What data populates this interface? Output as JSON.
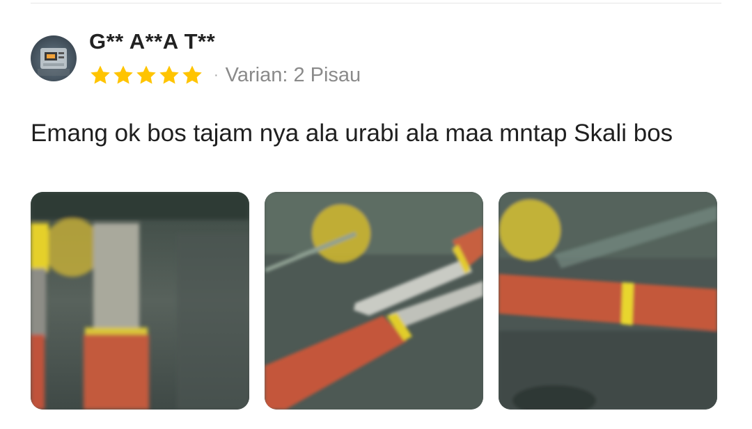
{
  "review": {
    "username": "G** A**A T**",
    "rating": 5,
    "rating_max": 5,
    "separator": "·",
    "variant": "Varian: 2 Pisau",
    "text": "Emang ok bos tajam nya ala urabi ala maa mntap Skali bos",
    "star_color": "#FFC400"
  },
  "photos": [
    {
      "name": "review-photo-1"
    },
    {
      "name": "review-photo-2"
    },
    {
      "name": "review-photo-3"
    }
  ]
}
